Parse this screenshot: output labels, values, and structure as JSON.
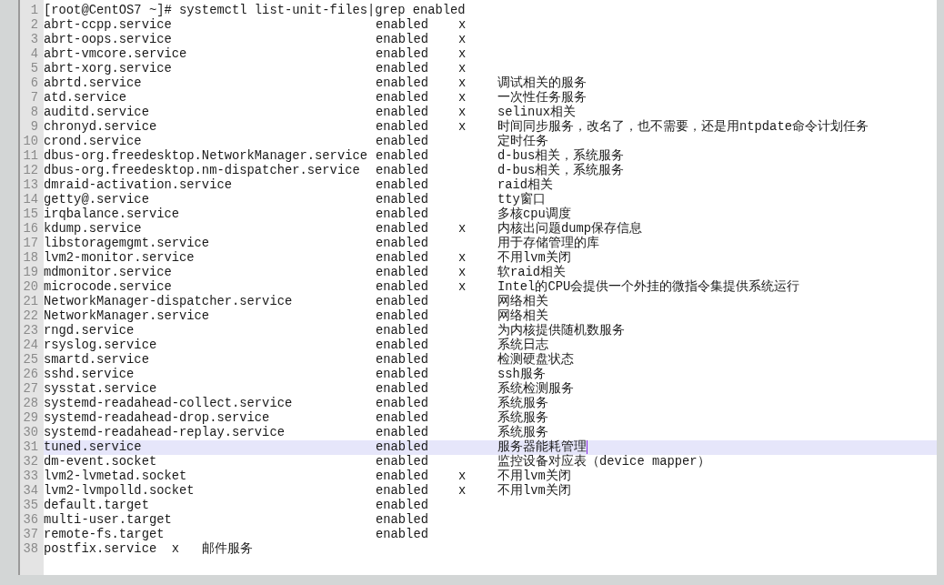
{
  "lines": [
    {
      "number": "1",
      "kind": "command",
      "text": "[root@CentOS7 ~]# systemctl list-unit-files|grep enabled",
      "current": false
    },
    {
      "number": "2",
      "kind": "entry",
      "unit": "abrt-ccpp.service",
      "state": "enabled",
      "mark": "x",
      "current": false
    },
    {
      "number": "3",
      "kind": "entry",
      "unit": "abrt-oops.service",
      "state": "enabled",
      "mark": "x",
      "current": false
    },
    {
      "number": "4",
      "kind": "entry",
      "unit": "abrt-vmcore.service",
      "state": "enabled",
      "mark": "x",
      "current": false
    },
    {
      "number": "5",
      "kind": "entry",
      "unit": "abrt-xorg.service",
      "state": "enabled",
      "mark": "x",
      "current": false
    },
    {
      "number": "6",
      "kind": "entry",
      "unit": "abrtd.service",
      "state": "enabled",
      "mark": "x",
      "comment": "调试相关的服务",
      "current": false
    },
    {
      "number": "7",
      "kind": "entry",
      "unit": "atd.service",
      "state": "enabled",
      "mark": "x",
      "comment": "一次性任务服务",
      "current": false
    },
    {
      "number": "8",
      "kind": "entry",
      "unit": "auditd.service",
      "state": "enabled",
      "mark": "x",
      "comment": "selinux相关",
      "current": false
    },
    {
      "number": "9",
      "kind": "entry",
      "unit": "chronyd.service",
      "state": "enabled",
      "mark": "x",
      "comment": "时间同步服务，改名了，也不需要，还是用ntpdate命令计划任务",
      "current": false
    },
    {
      "number": "10",
      "kind": "entry",
      "unit": "crond.service",
      "state": "enabled",
      "comment": "定时任务",
      "current": false
    },
    {
      "number": "11",
      "kind": "entry",
      "unit": "dbus-org.freedesktop.NetworkManager.service",
      "state": "enabled",
      "comment": "d-bus相关，系统服务",
      "current": false
    },
    {
      "number": "12",
      "kind": "entry",
      "unit": "dbus-org.freedesktop.nm-dispatcher.service",
      "state": "enabled",
      "comment": "d-bus相关，系统服务",
      "current": false
    },
    {
      "number": "13",
      "kind": "entry",
      "unit": "dmraid-activation.service",
      "state": "enabled",
      "comment": "raid相关",
      "current": false
    },
    {
      "number": "14",
      "kind": "entry",
      "unit": "getty@.service",
      "state": "enabled",
      "comment": "tty窗口",
      "current": false
    },
    {
      "number": "15",
      "kind": "entry",
      "unit": "irqbalance.service",
      "state": "enabled",
      "comment": "多核cpu调度",
      "current": false
    },
    {
      "number": "16",
      "kind": "entry",
      "unit": "kdump.service",
      "state": "enabled",
      "mark": "x",
      "comment": "内核出问题dump保存信息",
      "current": false
    },
    {
      "number": "17",
      "kind": "entry",
      "unit": "libstoragemgmt.service",
      "state": "enabled",
      "comment": "用于存储管理的库",
      "current": false
    },
    {
      "number": "18",
      "kind": "entry",
      "unit": "lvm2-monitor.service",
      "state": "enabled",
      "mark": "x",
      "comment": "不用lvm关闭",
      "current": false
    },
    {
      "number": "19",
      "kind": "entry",
      "unit": "mdmonitor.service",
      "state": "enabled",
      "mark": "x",
      "comment": "软raid相关",
      "current": false
    },
    {
      "number": "20",
      "kind": "entry",
      "unit": "microcode.service",
      "state": "enabled",
      "mark": "x",
      "comment": "Intel的CPU会提供一个外挂的微指令集提供系统运行",
      "current": false
    },
    {
      "number": "21",
      "kind": "entry",
      "unit": "NetworkManager-dispatcher.service",
      "state": "enabled",
      "comment": "网络相关",
      "current": false
    },
    {
      "number": "22",
      "kind": "entry",
      "unit": "NetworkManager.service",
      "state": "enabled",
      "comment": "网络相关",
      "current": false
    },
    {
      "number": "23",
      "kind": "entry",
      "unit": "rngd.service",
      "state": "enabled",
      "comment": "为内核提供随机数服务",
      "current": false
    },
    {
      "number": "24",
      "kind": "entry",
      "unit": "rsyslog.service",
      "state": "enabled",
      "comment": "系统日志",
      "current": false
    },
    {
      "number": "25",
      "kind": "entry",
      "unit": "smartd.service",
      "state": "enabled",
      "comment": "检测硬盘状态",
      "current": false
    },
    {
      "number": "26",
      "kind": "entry",
      "unit": "sshd.service",
      "state": "enabled",
      "comment": "ssh服务",
      "current": false
    },
    {
      "number": "27",
      "kind": "entry",
      "unit": "sysstat.service",
      "state": "enabled",
      "comment": "系统检测服务",
      "current": false
    },
    {
      "number": "28",
      "kind": "entry",
      "unit": "systemd-readahead-collect.service",
      "state": "enabled",
      "comment": "系统服务",
      "current": false
    },
    {
      "number": "29",
      "kind": "entry",
      "unit": "systemd-readahead-drop.service",
      "state": "enabled",
      "comment": "系统服务",
      "current": false
    },
    {
      "number": "30",
      "kind": "entry",
      "unit": "systemd-readahead-replay.service",
      "state": "enabled",
      "comment": "系统服务",
      "current": false
    },
    {
      "number": "31",
      "kind": "entry",
      "unit": "tuned.service",
      "state": "enabled",
      "comment": "服务器能耗管理",
      "current": true
    },
    {
      "number": "32",
      "kind": "entry",
      "unit": "dm-event.socket",
      "state": "enabled",
      "comment": "监控设备对应表（device mapper）",
      "current": false
    },
    {
      "number": "33",
      "kind": "entry",
      "unit": "lvm2-lvmetad.socket",
      "state": "enabled",
      "mark": "x",
      "comment": "不用lvm关闭",
      "current": false
    },
    {
      "number": "34",
      "kind": "entry",
      "unit": "lvm2-lvmpolld.socket",
      "state": "enabled",
      "mark": "x",
      "comment": "不用lvm关闭",
      "current": false
    },
    {
      "number": "35",
      "kind": "entry",
      "unit": "default.target",
      "state": "enabled",
      "current": false
    },
    {
      "number": "36",
      "kind": "entry",
      "unit": "multi-user.target",
      "state": "enabled",
      "current": false
    },
    {
      "number": "37",
      "kind": "entry",
      "unit": "remote-fs.target",
      "state": "enabled",
      "current": false
    },
    {
      "number": "38",
      "kind": "command",
      "text": "postfix.service  x   邮件服务",
      "current": false
    }
  ]
}
